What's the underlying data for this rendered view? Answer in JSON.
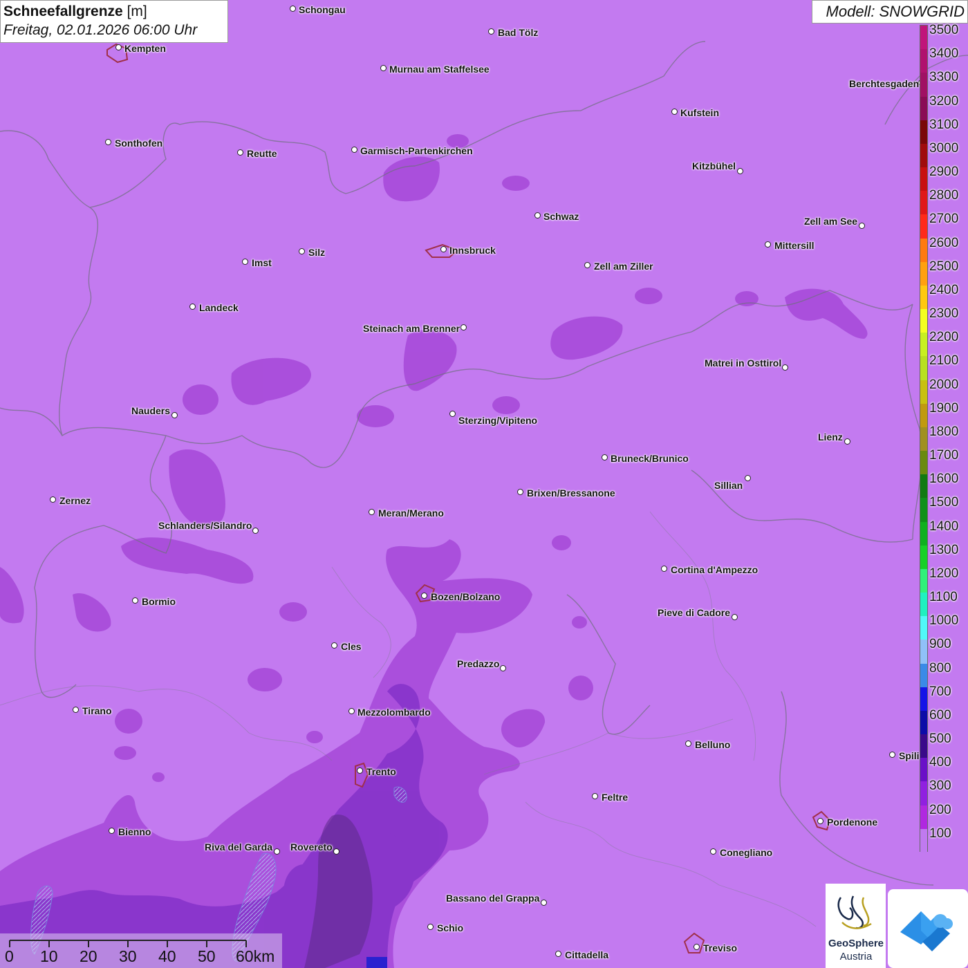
{
  "header": {
    "title_bold": "Schneefallgrenze",
    "title_unit": "[m]",
    "datetime": "Freitag, 02.01.2026 06:00 Uhr",
    "model": "Modell: SNOWGRID"
  },
  "legend": {
    "labels": [
      "3500",
      "3400",
      "3300",
      "3200",
      "3100",
      "3000",
      "2900",
      "2800",
      "2700",
      "2600",
      "2500",
      "2400",
      "2300",
      "2200",
      "2100",
      "2000",
      "1900",
      "1800",
      "1700",
      "1600",
      "1500",
      "1400",
      "1300",
      "1200",
      "1100",
      "1000",
      "900",
      "800",
      "700",
      "600",
      "500",
      "400",
      "300",
      "200",
      "100"
    ],
    "colors": [
      "#c0157a",
      "#b0126e",
      "#a01064",
      "#8a0c56",
      "#7a0808",
      "#a00c0c",
      "#c81010",
      "#e01818",
      "#ff2a1a",
      "#ff7a10",
      "#ffa010",
      "#ffc810",
      "#f4ff20",
      "#c8f020",
      "#b8e020",
      "#c8c010",
      "#c09a10",
      "#a09020",
      "#6a8a10",
      "#127a12",
      "#10901a",
      "#10b020",
      "#18d028",
      "#30f07a",
      "#20f0c0",
      "#50f8f8",
      "#90c0f8",
      "#3a8ae8",
      "#1414e8",
      "#0c0ca8",
      "#3a0a8a",
      "#6a10c8",
      "#9020e0",
      "#b028e0",
      "#c07af0"
    ]
  },
  "cities": [
    {
      "name": "Schongau"
    },
    {
      "name": "Bad Tölz"
    },
    {
      "name": "Kempten"
    },
    {
      "name": "Murnau am Staffelsee"
    },
    {
      "name": "Kufstein"
    },
    {
      "name": "Berchtesgaden"
    },
    {
      "name": "Sonthofen"
    },
    {
      "name": "Reutte"
    },
    {
      "name": "Garmisch-Partenkirchen"
    },
    {
      "name": "Kitzbühel"
    },
    {
      "name": "Schwaz"
    },
    {
      "name": "Zell am See"
    },
    {
      "name": "Innsbruck"
    },
    {
      "name": "Mittersill"
    },
    {
      "name": "Imst"
    },
    {
      "name": "Silz"
    },
    {
      "name": "Zell am Ziller"
    },
    {
      "name": "Landeck"
    },
    {
      "name": "Steinach am Brenner"
    },
    {
      "name": "Matrei in Osttirol"
    },
    {
      "name": "Nauders"
    },
    {
      "name": "Sterzing/Vipiteno"
    },
    {
      "name": "Lienz"
    },
    {
      "name": "Bruneck/Brunico"
    },
    {
      "name": "Sillian"
    },
    {
      "name": "Zernez"
    },
    {
      "name": "Brixen/Bressanone"
    },
    {
      "name": "Meran/Merano"
    },
    {
      "name": "Schlanders/Silandro"
    },
    {
      "name": "Cortina d'Ampezzo"
    },
    {
      "name": "Bozen/Bolzano"
    },
    {
      "name": "Bormio"
    },
    {
      "name": "Pieve di Cadore"
    },
    {
      "name": "Cles"
    },
    {
      "name": "Predazzo"
    },
    {
      "name": "Tirano"
    },
    {
      "name": "Mezzolombardo"
    },
    {
      "name": "Belluno"
    },
    {
      "name": "Spili"
    },
    {
      "name": "Trento"
    },
    {
      "name": "Feltre"
    },
    {
      "name": "Pordenone"
    },
    {
      "name": "Bienno"
    },
    {
      "name": "Riva del Garda"
    },
    {
      "name": "Rovereto"
    },
    {
      "name": "Conegliano"
    },
    {
      "name": "Bassano del Grappa"
    },
    {
      "name": "Schio"
    },
    {
      "name": "Treviso"
    },
    {
      "name": "Cittadella"
    }
  ],
  "scale": {
    "labels": [
      "0",
      "10",
      "20",
      "30",
      "40",
      "50",
      "60km"
    ]
  },
  "logos": {
    "geosphere_line1": "GeoSphere",
    "geosphere_line2": "Austria"
  }
}
